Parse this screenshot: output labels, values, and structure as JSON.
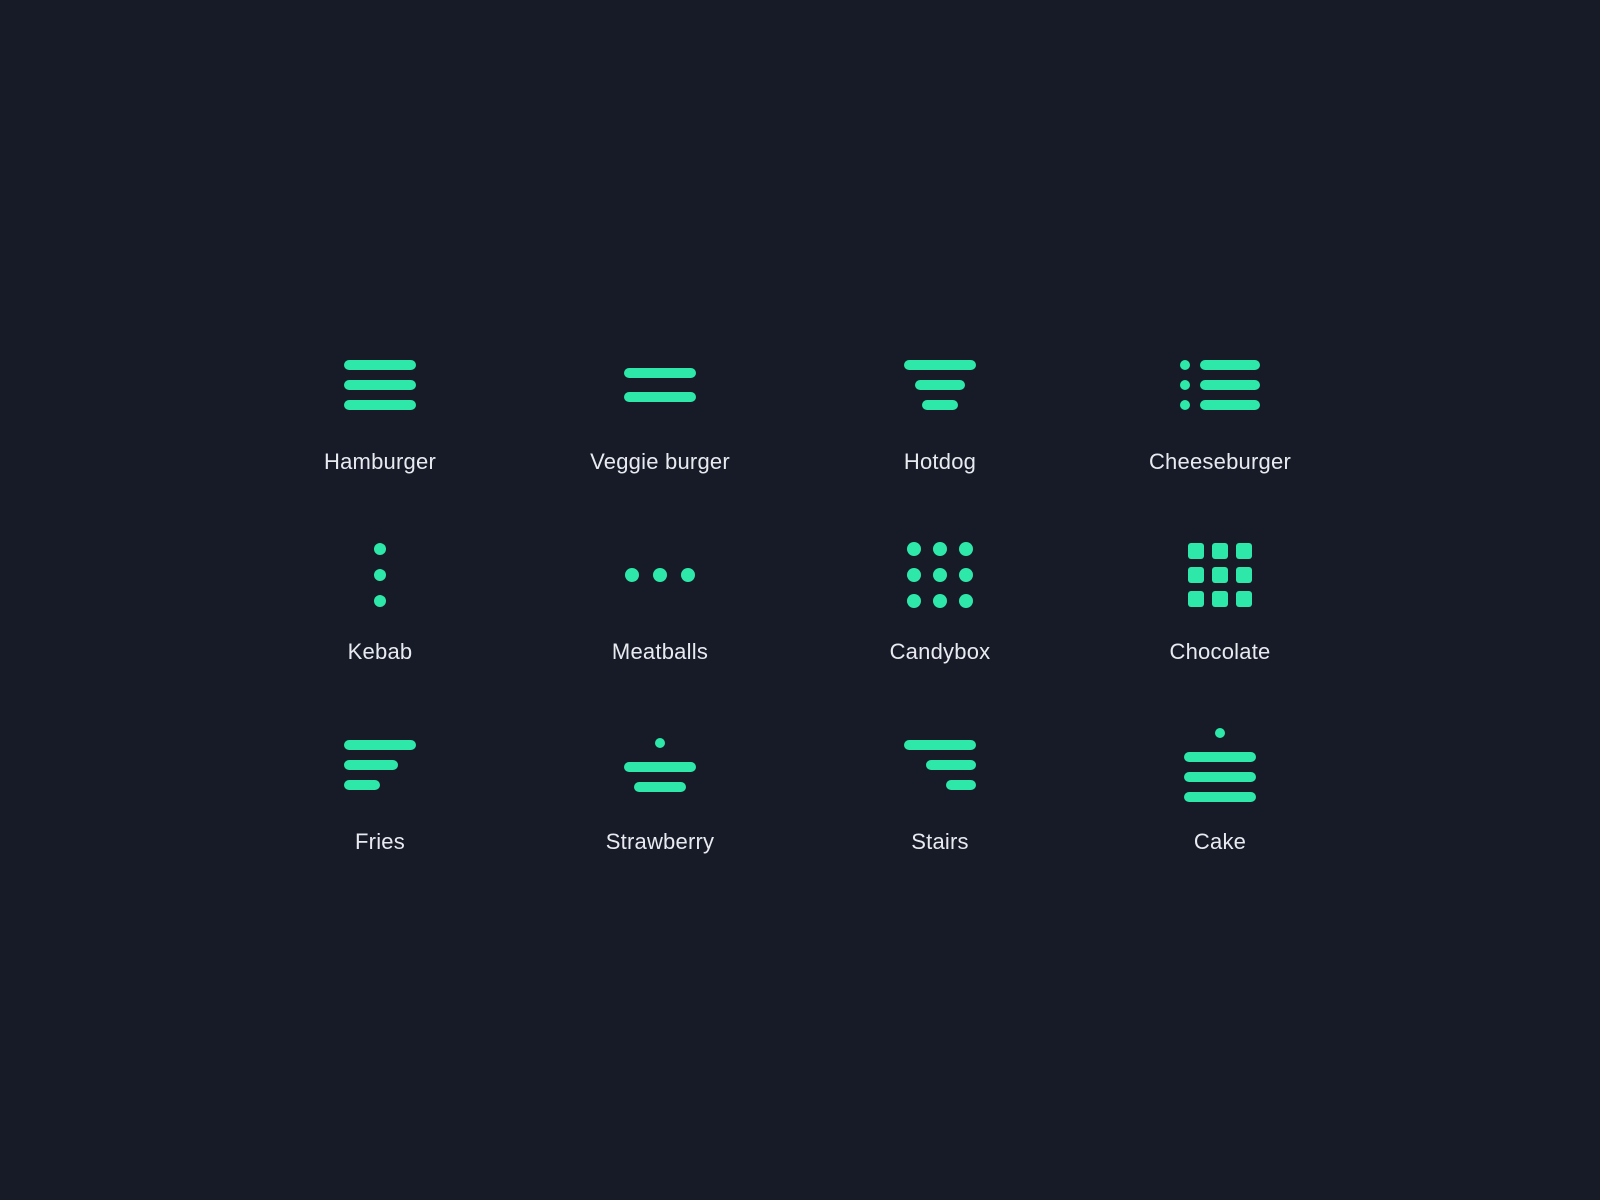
{
  "icons": [
    {
      "id": "hamburger",
      "label": "Hamburger"
    },
    {
      "id": "veggie",
      "label": "Veggie burger"
    },
    {
      "id": "hotdog",
      "label": "Hotdog"
    },
    {
      "id": "cheeseburger",
      "label": "Cheeseburger"
    },
    {
      "id": "kebab",
      "label": "Kebab"
    },
    {
      "id": "meatballs",
      "label": "Meatballs"
    },
    {
      "id": "candybox",
      "label": "Candybox"
    },
    {
      "id": "chocolate",
      "label": "Chocolate"
    },
    {
      "id": "fries",
      "label": "Fries"
    },
    {
      "id": "strawberry",
      "label": "Strawberry"
    },
    {
      "id": "stairs",
      "label": "Stairs"
    },
    {
      "id": "cake",
      "label": "Cake"
    }
  ],
  "accent": "#2de8a8"
}
